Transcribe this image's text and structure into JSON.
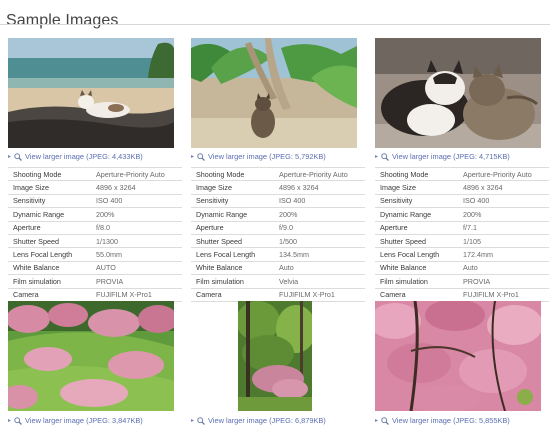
{
  "page": {
    "title": "Sample Images"
  },
  "labels": {
    "shooting_mode": "Shooting Mode",
    "image_size": "Image Size",
    "sensitivity": "Sensitivity",
    "dynamic_range": "Dynamic Range",
    "aperture": "Aperture",
    "shutter_speed": "Shutter Speed",
    "lens_focal_length": "Lens Focal Length",
    "white_balance": "White Balance",
    "film_simulation": "Film simulation",
    "camera": "Camera"
  },
  "samples": [
    {
      "link": "View larger image (JPEG: 4,433KB)",
      "image": "cat lying on rocks at the beach",
      "specs": {
        "shooting_mode": "Aperture-Priority Auto",
        "image_size": "4896 x 3264",
        "sensitivity": "ISO 400",
        "dynamic_range": "200%",
        "aperture": "f/8.0",
        "shutter_speed": "1/1300",
        "lens_focal_length": "55.0mm",
        "white_balance": "AUTO",
        "film_simulation": "PROVIA",
        "camera": "FUJIFILM X-Pro1"
      }
    },
    {
      "link": "View larger image (JPEG: 5,792KB)",
      "image": "cat sitting under tropical plants",
      "specs": {
        "shooting_mode": "Aperture-Priority Auto",
        "image_size": "4896 x 3264",
        "sensitivity": "ISO 400",
        "dynamic_range": "200%",
        "aperture": "f/9.0",
        "shutter_speed": "1/500",
        "lens_focal_length": "134.5mm",
        "white_balance": "Auto",
        "film_simulation": "Velvia",
        "camera": "FUJIFILM X-Pro1"
      }
    },
    {
      "link": "View larger image (JPEG: 4,715KB)",
      "image": "two cats sitting together",
      "specs": {
        "shooting_mode": "Aperture-Priority Auto",
        "image_size": "4896 x 3264",
        "sensitivity": "ISO 400",
        "dynamic_range": "200%",
        "aperture": "f/7.1",
        "shutter_speed": "1/105",
        "lens_focal_length": "172.4mm",
        "white_balance": "Auto",
        "film_simulation": "PROVIA",
        "camera": "FUJIFILM X-Pro1"
      }
    },
    {
      "link": "View larger image (JPEG: 3,847KB)",
      "image": "pink blossom orchard on a green hillside"
    },
    {
      "link": "View larger image (JPEG: 6,879KB)",
      "image": "blossoming tree in a forest"
    },
    {
      "link": "View larger image (JPEG: 5,855KB)",
      "image": "pink cherry blossoms close-up"
    }
  ],
  "icons": {
    "link_bullet": "triangle-right-icon",
    "link_icon": "magnifier-icon"
  },
  "colors": {
    "link": "#5b6fb3",
    "rule": "#dcdcdc",
    "title": "#444444"
  }
}
